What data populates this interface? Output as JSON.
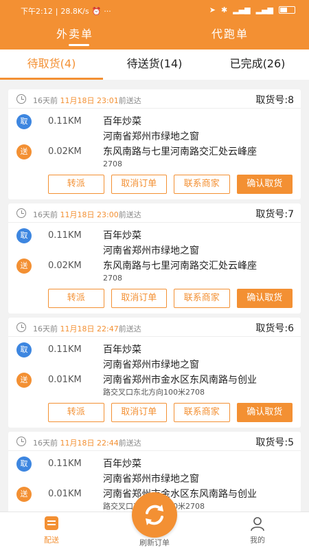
{
  "status_bar": {
    "time": "下午2:12",
    "speed": "28.8K/s"
  },
  "top_tabs": [
    {
      "label": "外卖单"
    },
    {
      "label": "代跑单"
    }
  ],
  "sub_tabs": [
    {
      "label": "待取货(4)"
    },
    {
      "label": "待送货(14)"
    },
    {
      "label": "已完成(26)"
    }
  ],
  "orders": [
    {
      "age": "16天前",
      "date": "11月18日",
      "deadline": "23:01",
      "suffix": "前送达",
      "pick_no": "取货号:8",
      "pick_dist": "0.11KM",
      "shop_name": "百年炒菜",
      "shop_addr": "河南省郑州市绿地之窗",
      "send_dist": "0.02KM",
      "dest_addr": "东风南路与七里河南路交汇处云峰座",
      "dest_extra": "2708"
    },
    {
      "age": "16天前",
      "date": "11月18日",
      "deadline": "23:00",
      "suffix": "前送达",
      "pick_no": "取货号:7",
      "pick_dist": "0.11KM",
      "shop_name": "百年炒菜",
      "shop_addr": "河南省郑州市绿地之窗",
      "send_dist": "0.02KM",
      "dest_addr": "东风南路与七里河南路交汇处云峰座",
      "dest_extra": "2708"
    },
    {
      "age": "16天前",
      "date": "11月18日",
      "deadline": "22:47",
      "suffix": "前送达",
      "pick_no": "取货号:6",
      "pick_dist": "0.11KM",
      "shop_name": "百年炒菜",
      "shop_addr": "河南省郑州市绿地之窗",
      "send_dist": "0.01KM",
      "dest_addr": "河南省郑州市金水区东风南路与创业",
      "dest_extra": "路交叉口东北方向100米2708"
    },
    {
      "age": "16天前",
      "date": "11月18日",
      "deadline": "22:44",
      "suffix": "前送达",
      "pick_no": "取货号:5",
      "pick_dist": "0.11KM",
      "shop_name": "百年炒菜",
      "shop_addr": "河南省郑州市绿地之窗",
      "send_dist": "0.01KM",
      "dest_addr": "河南省郑州市金水区东风南路与创业",
      "dest_extra": "路交叉口东北方向100米2708"
    }
  ],
  "labels": {
    "pick_badge": "取",
    "send_badge": "送"
  },
  "actions": {
    "transfer": "转派",
    "cancel": "取消订单",
    "contact": "联系商家",
    "confirm": "确认取货"
  },
  "bottom_nav": [
    {
      "label": "配送"
    },
    {
      "label": "刷新订单"
    },
    {
      "label": "我的"
    }
  ],
  "colors": {
    "accent": "#f39033",
    "pick_badge": "#3d86e0"
  }
}
